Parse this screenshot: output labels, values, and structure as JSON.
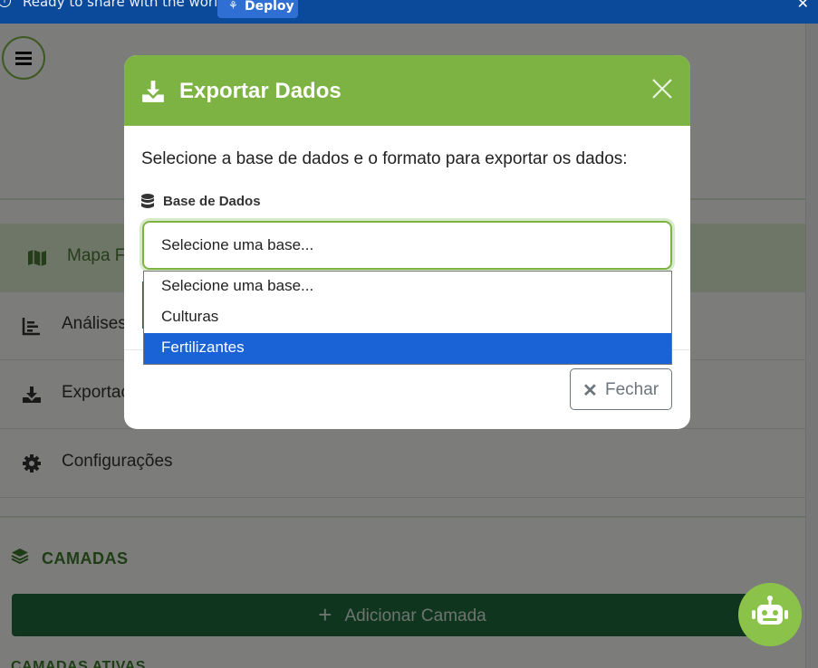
{
  "banner": {
    "message": "Ready to share with the world?",
    "deploy_label": "Deploy"
  },
  "sidebar": {
    "items": [
      {
        "label": "Mapa F",
        "icon": "map-icon"
      },
      {
        "label": "Análises",
        "icon": "chart-icon"
      },
      {
        "label": "Exportac",
        "icon": "download-icon"
      },
      {
        "label": "Configurações",
        "icon": "gear-icon"
      }
    ],
    "layers_title": "CAMADAS",
    "add_layer_label": "Adicionar Camada",
    "active_layers_title": "CAMADAS ATIVAS"
  },
  "modal": {
    "title": "Exportar Dados",
    "description": "Selecione a base de dados e o formato para exportar os dados:",
    "db_label": "Base de Dados",
    "select_value": "Selecione uma base...",
    "options": [
      "Selecione uma base...",
      "Culturas",
      "Fertilizantes"
    ],
    "highlighted_option": "Fertilizantes",
    "close_label": "Fechar"
  },
  "colors": {
    "accent_green": "#7cb342",
    "dark_green": "#1f6b3c",
    "banner_blue": "#0b4a9a",
    "selection_blue": "#1a63d6"
  }
}
